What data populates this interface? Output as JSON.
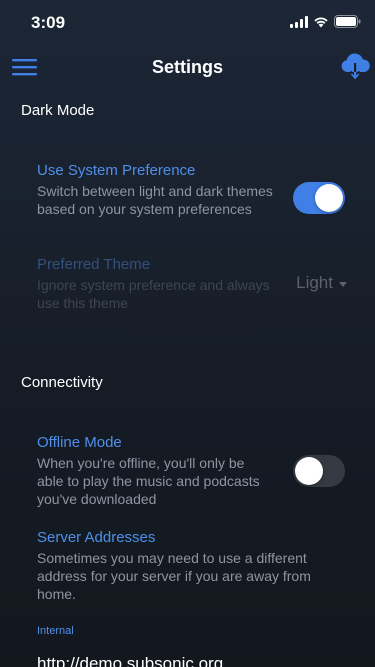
{
  "status_bar": {
    "time": "3:09"
  },
  "nav": {
    "title": "Settings",
    "menu_icon": "hamburger-menu-icon",
    "download_icon": "cloud-download-icon"
  },
  "sections": {
    "dark_mode": {
      "header": "Dark Mode",
      "use_system": {
        "title": "Use System Preference",
        "description": "Switch between light and dark themes based on your system preferences",
        "enabled": true
      },
      "preferred_theme": {
        "title": "Preferred Theme",
        "description": "Ignore system preference and always use this theme",
        "value": "Light",
        "disabled": true
      }
    },
    "connectivity": {
      "header": "Connectivity",
      "offline_mode": {
        "title": "Offline Mode",
        "description": "When you're offline, you'll only be able to play the music and podcasts you've downloaded",
        "enabled": false
      },
      "server_addresses": {
        "title": "Server Addresses",
        "description": "Sometimes you may need to use a different address for your server if you are away from home.",
        "internal_label": "Internal",
        "internal_value": "http://demo.subsonic.org"
      }
    }
  },
  "colors": {
    "accent": "#4f8fea",
    "toggle_on": "#3f7fe6",
    "toggle_off": "#353a42",
    "background": "#151b25"
  }
}
